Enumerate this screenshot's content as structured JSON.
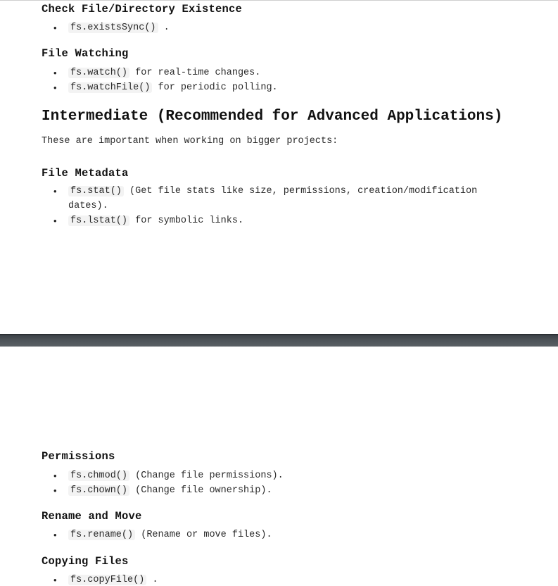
{
  "page1": {
    "s1": {
      "heading": "Check File/Directory Existence",
      "items": [
        {
          "code": "fs.existsSync()",
          "text": "."
        }
      ]
    },
    "s2": {
      "heading": "File Watching",
      "items": [
        {
          "code": "fs.watch()",
          "text": "for real-time changes."
        },
        {
          "code": "fs.watchFile()",
          "text": "for periodic polling."
        }
      ]
    },
    "section_title": "Intermediate (Recommended for Advanced Applications)",
    "intro": "These are important when working on bigger projects:",
    "s3": {
      "heading": "File Metadata",
      "items": [
        {
          "code": "fs.stat()",
          "text": "(Get file stats like size, permissions, creation/modification",
          "text2": "dates)."
        },
        {
          "code": "fs.lstat()",
          "text": "for symbolic links."
        }
      ]
    }
  },
  "page2": {
    "s4": {
      "heading": "Permissions",
      "items": [
        {
          "code": "fs.chmod()",
          "text": "(Change file permissions)."
        },
        {
          "code": "fs.chown()",
          "text": "(Change file ownership)."
        }
      ]
    },
    "s5": {
      "heading": "Rename and Move",
      "items": [
        {
          "code": "fs.rename()",
          "text": "(Rename or move files)."
        }
      ]
    },
    "s6": {
      "heading": "Copying Files",
      "items": [
        {
          "code": "fs.copyFile()",
          "text": "."
        }
      ]
    }
  }
}
